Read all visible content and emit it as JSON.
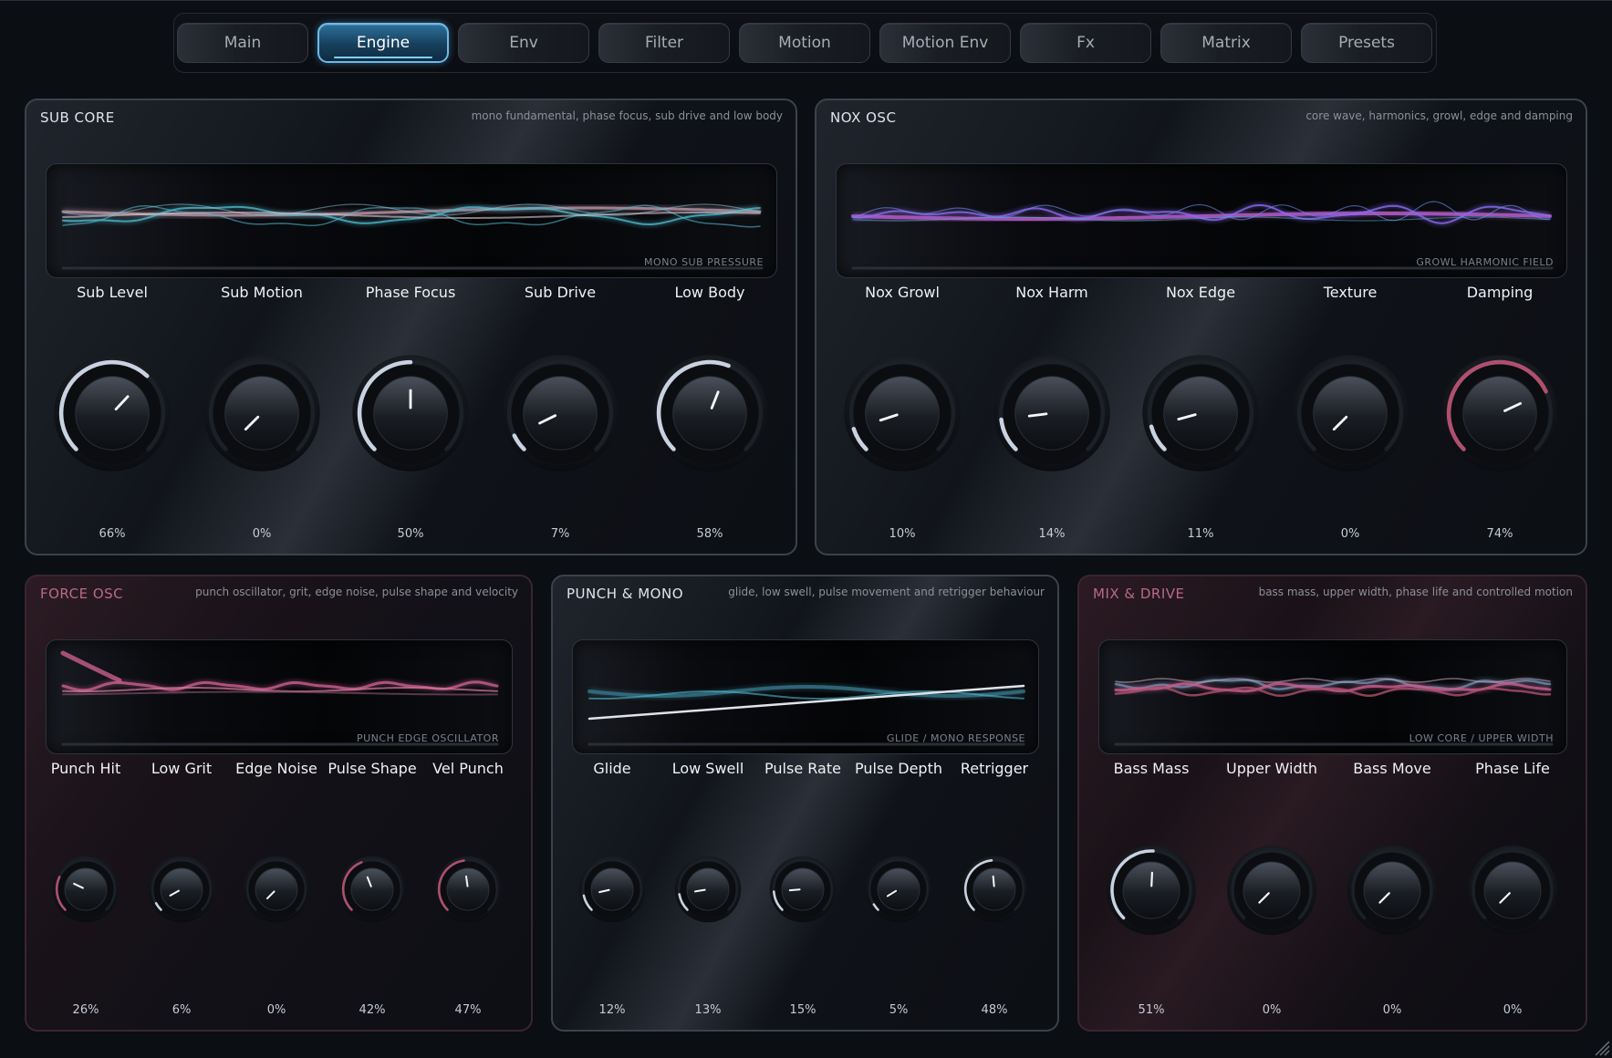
{
  "tabs": [
    {
      "label": "Main",
      "active": false
    },
    {
      "label": "Engine",
      "active": true
    },
    {
      "label": "Env",
      "active": false
    },
    {
      "label": "Filter",
      "active": false
    },
    {
      "label": "Motion",
      "active": false
    },
    {
      "label": "Motion Env",
      "active": false
    },
    {
      "label": "Fx",
      "active": false
    },
    {
      "label": "Matrix",
      "active": false
    },
    {
      "label": "Presets",
      "active": false
    }
  ],
  "sub_core": {
    "title": "SUB CORE",
    "desc": "mono fundamental, phase focus, sub drive and low body",
    "display_label": "MONO SUB PRESSURE",
    "knobs": [
      {
        "label": "Sub Level",
        "value": "66%",
        "fraction": 0.66
      },
      {
        "label": "Sub Motion",
        "value": "0%",
        "fraction": 0
      },
      {
        "label": "Phase Focus",
        "value": "50%",
        "fraction": 0.5
      },
      {
        "label": "Sub Drive",
        "value": "7%",
        "fraction": 0.07
      },
      {
        "label": "Low Body",
        "value": "58%",
        "fraction": 0.58
      }
    ]
  },
  "nox_osc": {
    "title": "NOX OSC",
    "desc": "core wave, harmonics, growl, edge and damping",
    "display_label": "GROWL HARMONIC FIELD",
    "knobs": [
      {
        "label": "Nox Growl",
        "value": "10%",
        "fraction": 0.1
      },
      {
        "label": "Nox Harm",
        "value": "14%",
        "fraction": 0.14
      },
      {
        "label": "Nox Edge",
        "value": "11%",
        "fraction": 0.11
      },
      {
        "label": "Texture",
        "value": "0%",
        "fraction": 0
      },
      {
        "label": "Damping",
        "value": "74%",
        "fraction": 0.74
      }
    ]
  },
  "force_osc": {
    "title": "FORCE OSC",
    "desc": "punch oscillator, grit, edge noise, pulse shape and velocity",
    "display_label": "PUNCH EDGE OSCILLATOR",
    "knobs": [
      {
        "label": "Punch Hit",
        "value": "26%",
        "fraction": 0.26
      },
      {
        "label": "Low Grit",
        "value": "6%",
        "fraction": 0.06
      },
      {
        "label": "Edge Noise",
        "value": "0%",
        "fraction": 0
      },
      {
        "label": "Pulse Shape",
        "value": "42%",
        "fraction": 0.42
      },
      {
        "label": "Vel Punch",
        "value": "47%",
        "fraction": 0.47
      }
    ]
  },
  "punch_mono": {
    "title": "PUNCH & MONO",
    "desc": "glide, low swell, pulse movement and retrigger behaviour",
    "display_label": "GLIDE / MONO RESPONSE",
    "knobs": [
      {
        "label": "Glide",
        "value": "12%",
        "fraction": 0.12
      },
      {
        "label": "Low Swell",
        "value": "13%",
        "fraction": 0.13
      },
      {
        "label": "Pulse Rate",
        "value": "15%",
        "fraction": 0.15
      },
      {
        "label": "Pulse Depth",
        "value": "5%",
        "fraction": 0.05
      },
      {
        "label": "Retrigger",
        "value": "48%",
        "fraction": 0.48
      }
    ]
  },
  "mix_drive": {
    "title": "MIX & DRIVE",
    "desc": "bass mass, upper width, phase life and controlled motion",
    "display_label": "LOW CORE / UPPER WIDTH",
    "knobs": [
      {
        "label": "Bass Mass",
        "value": "51%",
        "fraction": 0.51
      },
      {
        "label": "Upper Width",
        "value": "0%",
        "fraction": 0
      },
      {
        "label": "Bass Move",
        "value": "0%",
        "fraction": 0
      },
      {
        "label": "Phase Life",
        "value": "0%",
        "fraction": 0
      }
    ]
  },
  "colors": {
    "arc_default": "#c9d2e0",
    "arc_red": "#b0506e",
    "accent_blue": "#6db9e8",
    "wave_cyan": "#4fb6c9",
    "wave_pink": "#c95f8f",
    "wave_purple": "#8a6cf0"
  }
}
